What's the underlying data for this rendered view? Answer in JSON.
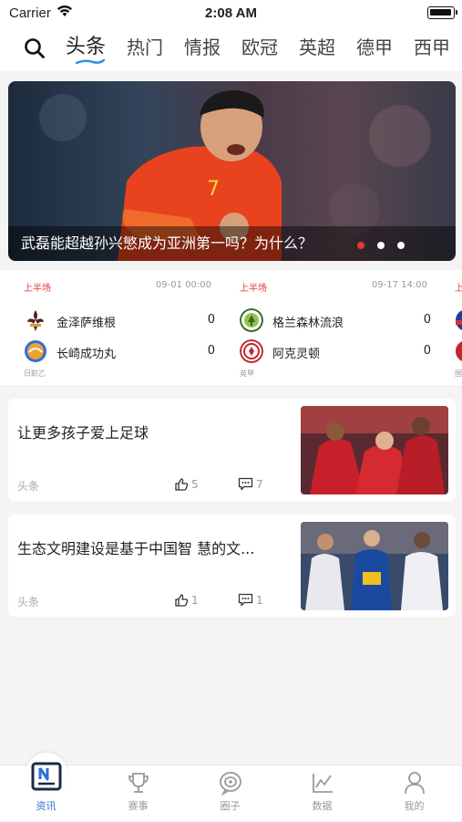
{
  "status_bar": {
    "carrier": "Carrier",
    "time": "2:08 AM"
  },
  "nav": {
    "tabs": [
      {
        "label": "头条",
        "active": true
      },
      {
        "label": "热门"
      },
      {
        "label": "情报"
      },
      {
        "label": "欧冠"
      },
      {
        "label": "英超"
      },
      {
        "label": "德甲"
      },
      {
        "label": "西甲"
      }
    ]
  },
  "banner": {
    "caption": "武磊能超越孙兴慜成为亚洲第一吗？为什么？",
    "slides": 3,
    "active_slide": 0
  },
  "matches": [
    {
      "period": "上半场",
      "date": "09-01 00:00",
      "league": "日职乙",
      "home": {
        "name": "金泽萨维根",
        "score": "0"
      },
      "away": {
        "name": "长崎成功丸",
        "score": "0"
      }
    },
    {
      "period": "上半场",
      "date": "09-17 14:00",
      "league": "英甲",
      "home": {
        "name": "格兰森林流浪",
        "score": "0"
      },
      "away": {
        "name": "阿克灵顿",
        "score": "0"
      }
    },
    {
      "period": "上",
      "date": "",
      "league": "国",
      "home": {
        "name": "",
        "score": ""
      },
      "away": {
        "name": "",
        "score": ""
      }
    }
  ],
  "news": [
    {
      "title": "让更多孩子爱上足球",
      "source": "头条",
      "likes": "5",
      "comments": "7"
    },
    {
      "title": "生态文明建设是基于中国智 慧的文...",
      "source": "头条",
      "likes": "1",
      "comments": "1"
    }
  ],
  "tab_bar": {
    "items": [
      {
        "label": "资讯",
        "icon": "news-icon",
        "active": true
      },
      {
        "label": "赛事",
        "icon": "trophy-icon"
      },
      {
        "label": "圈子",
        "icon": "circle-icon"
      },
      {
        "label": "数据",
        "icon": "chart-icon"
      },
      {
        "label": "我的",
        "icon": "profile-icon"
      }
    ]
  },
  "colors": {
    "accent_red": "#e53935",
    "accent_blue": "#2f6fd6"
  }
}
